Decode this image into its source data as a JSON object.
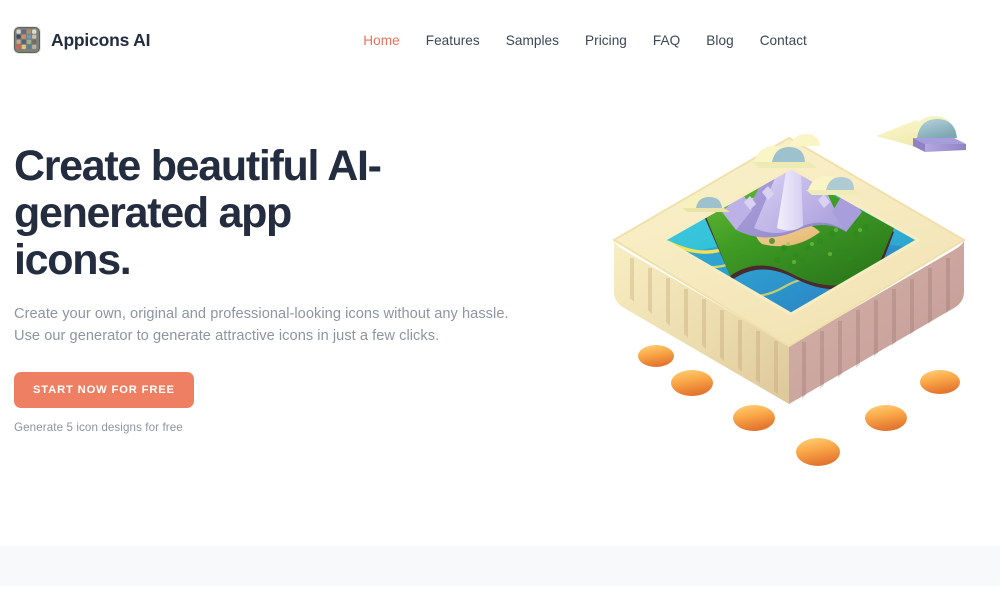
{
  "header": {
    "brand": {
      "name": "Appicons AI",
      "logo_icon": "app-grid-logo-icon"
    },
    "nav": [
      {
        "label": "Home",
        "active": true
      },
      {
        "label": "Features",
        "active": false
      },
      {
        "label": "Samples",
        "active": false
      },
      {
        "label": "Pricing",
        "active": false
      },
      {
        "label": "FAQ",
        "active": false
      },
      {
        "label": "Blog",
        "active": false
      },
      {
        "label": "Contact",
        "active": false
      }
    ]
  },
  "hero": {
    "title": "Create beautiful AI-generated app icons.",
    "subtitle": "Create your own, original and professional-looking icons without any hassle. Use our generator to generate attractive icons in just a few clicks.",
    "cta_label": "Start now for free",
    "cta_note": "Generate 5 icon designs for free",
    "illustration_icon": "island-volcano-3d-app-icon"
  },
  "colors": {
    "accent": "#ef7f62",
    "nav_active": "#e8735a",
    "heading": "#232d3f",
    "body_text": "#8e94a0",
    "page_bg": "#ffffff",
    "section_bg": "#f8f9fb"
  }
}
